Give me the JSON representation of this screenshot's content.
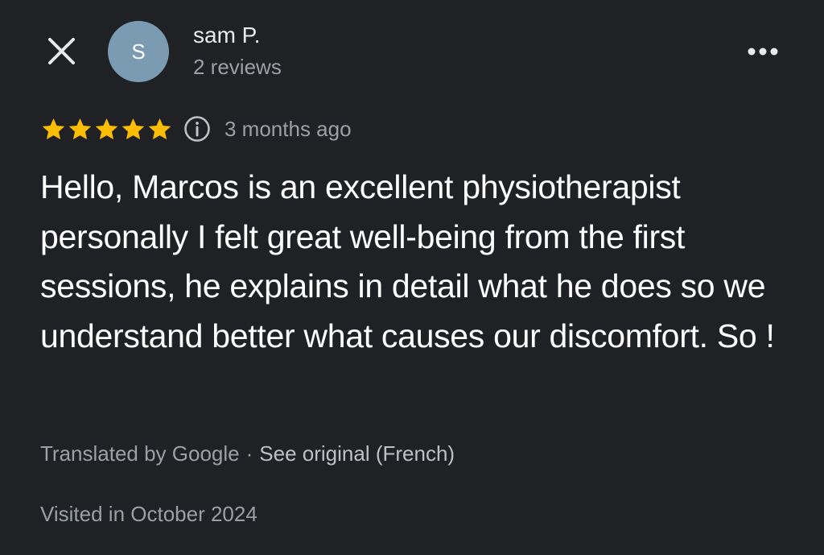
{
  "header": {
    "close_icon": "close-icon",
    "avatar_initial": "S",
    "avatar_color": "#7a9bb1",
    "user_name": "sam P.",
    "user_reviews": "2 reviews",
    "more_icon": "more-horizontal-icon"
  },
  "rating": {
    "stars": 5,
    "max_stars": 5,
    "star_color": "#fbbc04",
    "info_icon": "info-icon",
    "time_ago": "3 months ago"
  },
  "review": {
    "text": "Hello, Marcos is an excellent physiotherapist personally I felt great well-being from the first sessions, he explains in detail what he does so we understand better what causes our discomfort. So !"
  },
  "translation": {
    "translated_by": "Translated by Google",
    "separator": "·",
    "see_original": "See original (French)"
  },
  "visit": {
    "visited": "Visited in October 2024"
  },
  "colors": {
    "background": "#202124",
    "primary_text": "#ffffff",
    "secondary_text": "#9aa0a6"
  }
}
